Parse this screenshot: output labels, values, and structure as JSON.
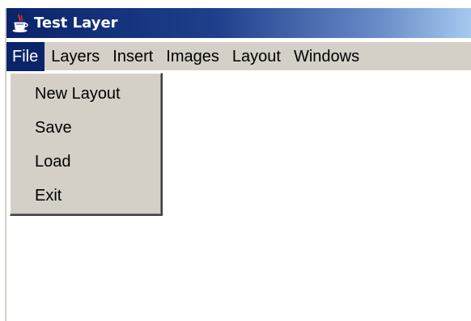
{
  "window": {
    "title": "Test Layer"
  },
  "menubar": {
    "items": [
      {
        "label": "File"
      },
      {
        "label": "Layers"
      },
      {
        "label": "Insert"
      },
      {
        "label": "Images"
      },
      {
        "label": "Layout"
      },
      {
        "label": "Windows"
      }
    ],
    "active_index": 0
  },
  "file_menu": {
    "items": [
      {
        "label": "New Layout"
      },
      {
        "label": "Save"
      },
      {
        "label": "Load"
      },
      {
        "label": "Exit"
      }
    ]
  },
  "icons": {
    "app": "java-coffee-cup-icon"
  },
  "colors": {
    "title_bar_start": "#0a246a",
    "title_bar_end": "#a6caf0",
    "menu_background": "#d4d0c8",
    "menu_highlight": "#0a246a"
  }
}
